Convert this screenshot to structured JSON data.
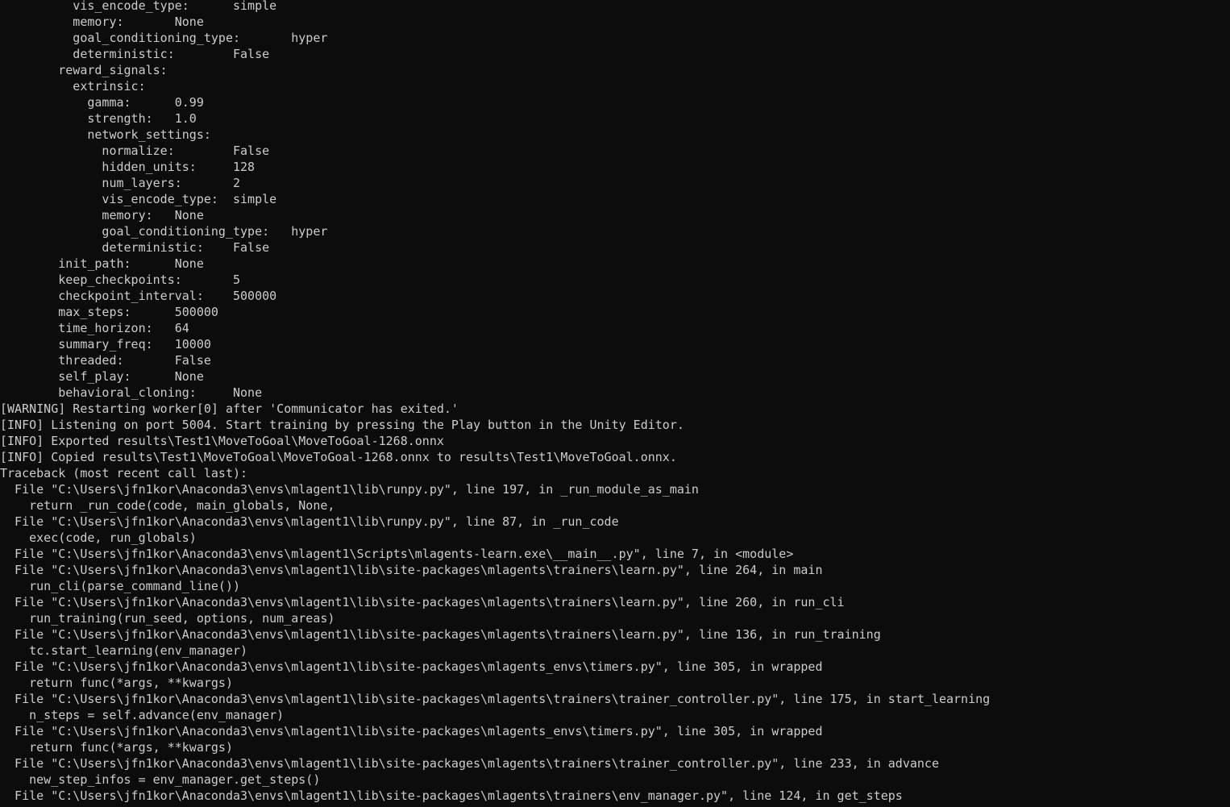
{
  "colors": {
    "background": "#0c0c0c",
    "text": "#cccccc"
  },
  "console": {
    "lines": [
      "          vis_encode_type:      simple",
      "          memory:       None",
      "          goal_conditioning_type:       hyper",
      "          deterministic:        False",
      "        reward_signals:",
      "          extrinsic:",
      "            gamma:      0.99",
      "            strength:   1.0",
      "            network_settings:",
      "              normalize:        False",
      "              hidden_units:     128",
      "              num_layers:       2",
      "              vis_encode_type:  simple",
      "              memory:   None",
      "              goal_conditioning_type:   hyper",
      "              deterministic:    False",
      "        init_path:      None",
      "        keep_checkpoints:       5",
      "        checkpoint_interval:    500000",
      "        max_steps:      500000",
      "        time_horizon:   64",
      "        summary_freq:   10000",
      "        threaded:       False",
      "        self_play:      None",
      "        behavioral_cloning:     None",
      "[WARNING] Restarting worker[0] after 'Communicator has exited.'",
      "[INFO] Listening on port 5004. Start training by pressing the Play button in the Unity Editor.",
      "[INFO] Exported results\\Test1\\MoveToGoal\\MoveToGoal-1268.onnx",
      "[INFO] Copied results\\Test1\\MoveToGoal\\MoveToGoal-1268.onnx to results\\Test1\\MoveToGoal.onnx.",
      "Traceback (most recent call last):",
      "  File \"C:\\Users\\jfn1kor\\Anaconda3\\envs\\mlagent1\\lib\\runpy.py\", line 197, in _run_module_as_main",
      "    return _run_code(code, main_globals, None,",
      "  File \"C:\\Users\\jfn1kor\\Anaconda3\\envs\\mlagent1\\lib\\runpy.py\", line 87, in _run_code",
      "    exec(code, run_globals)",
      "  File \"C:\\Users\\jfn1kor\\Anaconda3\\envs\\mlagent1\\Scripts\\mlagents-learn.exe\\__main__.py\", line 7, in <module>",
      "  File \"C:\\Users\\jfn1kor\\Anaconda3\\envs\\mlagent1\\lib\\site-packages\\mlagents\\trainers\\learn.py\", line 264, in main",
      "    run_cli(parse_command_line())",
      "  File \"C:\\Users\\jfn1kor\\Anaconda3\\envs\\mlagent1\\lib\\site-packages\\mlagents\\trainers\\learn.py\", line 260, in run_cli",
      "    run_training(run_seed, options, num_areas)",
      "  File \"C:\\Users\\jfn1kor\\Anaconda3\\envs\\mlagent1\\lib\\site-packages\\mlagents\\trainers\\learn.py\", line 136, in run_training",
      "    tc.start_learning(env_manager)",
      "  File \"C:\\Users\\jfn1kor\\Anaconda3\\envs\\mlagent1\\lib\\site-packages\\mlagents_envs\\timers.py\", line 305, in wrapped",
      "    return func(*args, **kwargs)",
      "  File \"C:\\Users\\jfn1kor\\Anaconda3\\envs\\mlagent1\\lib\\site-packages\\mlagents\\trainers\\trainer_controller.py\", line 175, in start_learning",
      "    n_steps = self.advance(env_manager)",
      "  File \"C:\\Users\\jfn1kor\\Anaconda3\\envs\\mlagent1\\lib\\site-packages\\mlagents_envs\\timers.py\", line 305, in wrapped",
      "    return func(*args, **kwargs)",
      "  File \"C:\\Users\\jfn1kor\\Anaconda3\\envs\\mlagent1\\lib\\site-packages\\mlagents\\trainers\\trainer_controller.py\", line 233, in advance",
      "    new_step_infos = env_manager.get_steps()",
      "  File \"C:\\Users\\jfn1kor\\Anaconda3\\envs\\mlagent1\\lib\\site-packages\\mlagents\\trainers\\env_manager.py\", line 124, in get_steps"
    ]
  }
}
